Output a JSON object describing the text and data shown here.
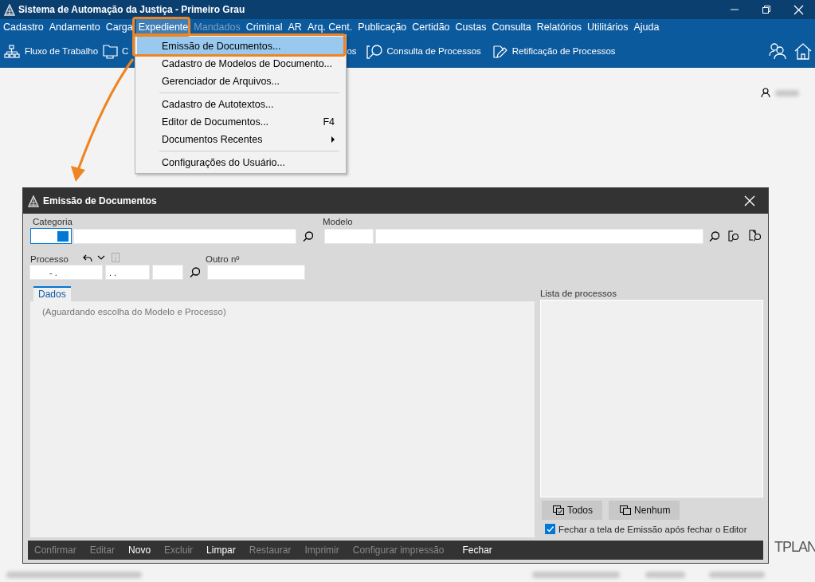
{
  "window": {
    "title": "Sistema de Automação da Justiça - Primeiro Grau"
  },
  "menubar": [
    {
      "label": "Cadastro",
      "selected": false,
      "disabled": false
    },
    {
      "label": "Andamento",
      "selected": false,
      "disabled": false
    },
    {
      "label": "Carga",
      "selected": false,
      "disabled": false
    },
    {
      "label": "Expediente",
      "selected": true,
      "disabled": false
    },
    {
      "label": "Mandados",
      "selected": false,
      "disabled": true
    },
    {
      "label": "Criminal",
      "selected": false,
      "disabled": false
    },
    {
      "label": "AR",
      "selected": false,
      "disabled": false
    },
    {
      "label": "Arq. Cent.",
      "selected": false,
      "disabled": false
    },
    {
      "label": "Publicação",
      "selected": false,
      "disabled": false
    },
    {
      "label": "Certidão",
      "selected": false,
      "disabled": false
    },
    {
      "label": "Custas",
      "selected": false,
      "disabled": false
    },
    {
      "label": "Consulta",
      "selected": false,
      "disabled": false
    },
    {
      "label": "Relatórios",
      "selected": false,
      "disabled": false
    },
    {
      "label": "Utilitários",
      "selected": false,
      "disabled": false
    },
    {
      "label": "Ajuda",
      "selected": false,
      "disabled": false
    }
  ],
  "toolbar": [
    {
      "label": "Fluxo de Trabalho",
      "kind": "flow"
    },
    {
      "label": "C",
      "kind": "folder"
    },
    {
      "label": "os",
      "kind": "text"
    },
    {
      "label": "Consulta de Processos",
      "kind": "search"
    },
    {
      "label": "Retificação de Processos",
      "kind": "edit"
    }
  ],
  "menu": {
    "items": [
      {
        "kind": "item",
        "label": "Emissão de Documentos...",
        "selected": true
      },
      {
        "kind": "item",
        "label": "Cadastro de Modelos de Documento...",
        "selected": false
      },
      {
        "kind": "item",
        "label": "Gerenciador de Arquivos...",
        "selected": false
      },
      {
        "kind": "separator"
      },
      {
        "kind": "item",
        "label": "Cadastro de Autotextos...",
        "selected": false
      },
      {
        "kind": "item",
        "label": "Editor de Documentos...",
        "selected": false,
        "shortcut": "F4"
      },
      {
        "kind": "submenu",
        "label": "Documentos Recentes",
        "selected": false
      },
      {
        "kind": "separator"
      },
      {
        "kind": "item",
        "label": "Configurações do Usuário...",
        "selected": false
      }
    ]
  },
  "dialog": {
    "title": "Emissão de Documentos",
    "categoria_label": "Categoria",
    "modelo_label": "Modelo",
    "processo": {
      "label": "Processo",
      "value_1": "- .",
      "value_2": ". ."
    },
    "outro_label": "Outro nº",
    "tabs": [
      {
        "label": "Dados",
        "selected": true
      }
    ],
    "panel_message": "(Aguardando escolha do Modelo e Processo)",
    "list_label": "Lista de processos",
    "list_buttons": [
      {
        "label": "Todos",
        "kind": "all"
      },
      {
        "label": "Nenhum",
        "kind": "none"
      }
    ],
    "close_option": {
      "label": "Fechar a tela de Emissão após fechar o Editor",
      "checked": true
    },
    "actions": [
      {
        "label": "Confirmar",
        "disabled": true
      },
      {
        "label": "Editar",
        "disabled": true
      },
      {
        "label": "Novo",
        "disabled": false
      },
      {
        "label": "Excluir",
        "disabled": true
      },
      {
        "label": "Limpar",
        "disabled": false
      },
      {
        "label": "Restaurar",
        "disabled": true
      },
      {
        "label": "Imprimir",
        "disabled": true
      },
      {
        "label": "Configurar impressão",
        "disabled": true
      },
      {
        "label": "Fechar",
        "disabled": false
      }
    ]
  },
  "background_logo_text": "TPLAN"
}
